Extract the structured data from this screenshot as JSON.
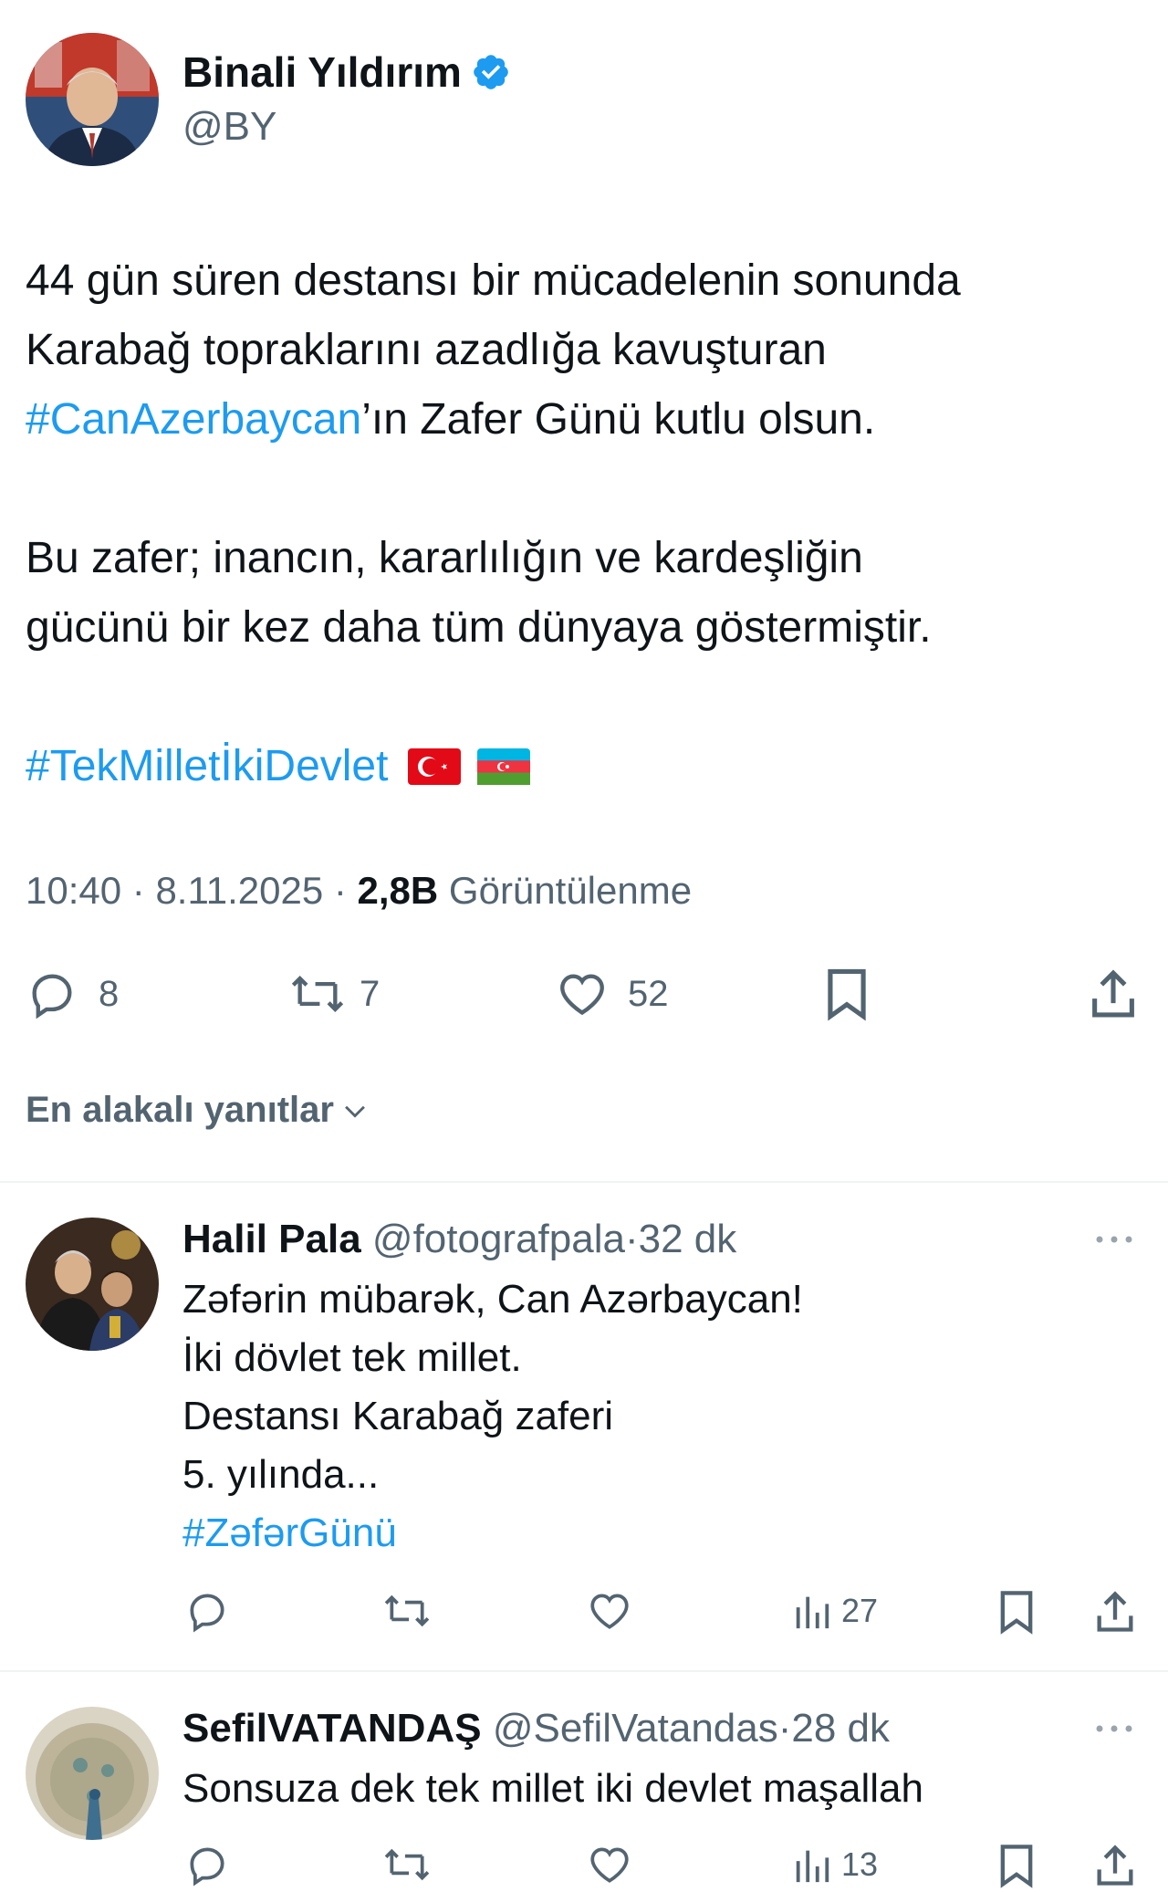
{
  "tweet": {
    "author": {
      "name": "Binali Yıldırım",
      "handle": "@BY"
    },
    "body": {
      "p1": [
        "44 gün süren destansı bir mücadelenin sonunda",
        "Karabağ topraklarını azadlığa kavuşturan"
      ],
      "p1_hashtag": "#CanAzerbaycan",
      "p1_tail": "’ın Zafer Günü kutlu olsun.",
      "p2": [
        "Bu zafer; inancın, kararlılığın ve kardeşliğin",
        "gücünü bir kez daha tüm dünyaya göstermiştir."
      ],
      "p3_hashtag": "#TekMilletİkiDevlet",
      "flags": [
        "turkey-flag-icon",
        "azerbaijan-flag-icon"
      ]
    },
    "meta": {
      "time": "10:40",
      "sep1": "·",
      "date": "8.11.2025",
      "sep2": "·",
      "views": "2,8B",
      "views_label": "Görüntülenme"
    },
    "actions": {
      "replies": "8",
      "retweets": "7",
      "likes": "52"
    }
  },
  "replies_sort": {
    "label": "En alakalı yanıtlar"
  },
  "replies": [
    {
      "name": "Halil Pala",
      "handle": "@fotografpala",
      "sep": "·",
      "time": "32 dk",
      "lines": [
        "Zəfərin mübarək, Can Azərbaycan!",
        "İki dövlet tek millet.",
        "Destansı Karabağ zaferi",
        "5. yılında..."
      ],
      "hashtag": "#ZəfərGünü",
      "views": "27"
    },
    {
      "name": "SefilVATANDAŞ",
      "handle": "@SefilVatandas",
      "sep": "·",
      "time": "28 dk",
      "lines": [
        "Sonsuza dek tek millet iki devlet maşallah"
      ],
      "views": "13"
    }
  ],
  "colors": {
    "accent": "#1d9bf0",
    "muted": "#536471",
    "text": "#0f1419",
    "divider": "#eff3f4"
  }
}
